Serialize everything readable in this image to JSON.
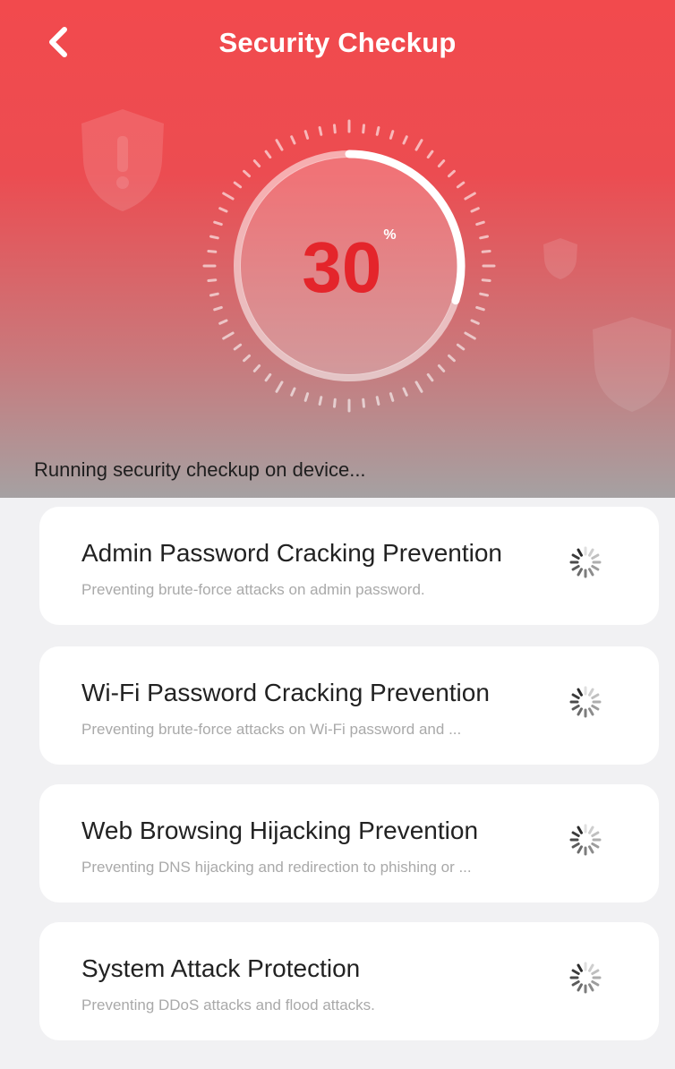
{
  "header": {
    "title": "Security Checkup",
    "back_icon": "chevron-left-icon"
  },
  "progress": {
    "value": "30",
    "unit": "%",
    "fraction": 0.3
  },
  "status": {
    "text": "Running security checkup on device..."
  },
  "items": [
    {
      "title": "Admin Password Cracking Prevention",
      "description": "Preventing brute-force attacks on admin password.",
      "state_icon": "loading-spinner-icon"
    },
    {
      "title": "Wi-Fi Password Cracking Prevention",
      "description": "Preventing brute-force attacks on Wi-Fi password and ...",
      "state_icon": "loading-spinner-icon"
    },
    {
      "title": "Web Browsing Hijacking Prevention",
      "description": "Preventing DNS hijacking and redirection to phishing or ...",
      "state_icon": "loading-spinner-icon"
    },
    {
      "title": "System Attack Protection",
      "description": "Preventing DDoS attacks and flood attacks.",
      "state_icon": "loading-spinner-icon"
    }
  ],
  "colors": {
    "accent_red": "#e4252b",
    "header_red": "#f24a4d",
    "card_bg": "#ffffff",
    "page_bg": "#f1f1f3"
  }
}
